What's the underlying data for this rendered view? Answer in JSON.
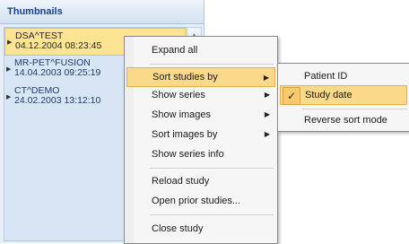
{
  "panel": {
    "title": "Thumbnails",
    "items": [
      {
        "name": "DSA^TEST",
        "date": "04.12.2004 08:23:45",
        "selected": true
      },
      {
        "name": "MR-PET^FUSION",
        "date": "14.04.2003 09:25:19",
        "selected": false
      },
      {
        "name": "CT^DEMO",
        "date": "24.02.2003 13:12:10",
        "selected": false
      }
    ]
  },
  "context_menu": {
    "items": [
      {
        "label": "Expand all",
        "has_submenu": false
      },
      {
        "label": "Sort studies by",
        "has_submenu": true,
        "highlighted": true
      },
      {
        "label": "Show series",
        "has_submenu": true
      },
      {
        "label": "Show images",
        "has_submenu": true
      },
      {
        "label": "Sort images by",
        "has_submenu": true
      },
      {
        "label": "Show series info",
        "has_submenu": false
      },
      {
        "label": "Reload study",
        "has_submenu": false
      },
      {
        "label": "Open prior studies...",
        "has_submenu": false
      },
      {
        "label": "Close study",
        "has_submenu": false
      }
    ]
  },
  "submenu": {
    "items": [
      {
        "label": "Patient ID",
        "checked": false
      },
      {
        "label": "Study date",
        "checked": true,
        "highlighted": true
      },
      {
        "label": "Reverse sort mode",
        "checked": false
      }
    ]
  },
  "colors": {
    "highlight": "#fbd98a",
    "selected_item": "#fce493",
    "panel_bg": "#d8e5f4"
  }
}
